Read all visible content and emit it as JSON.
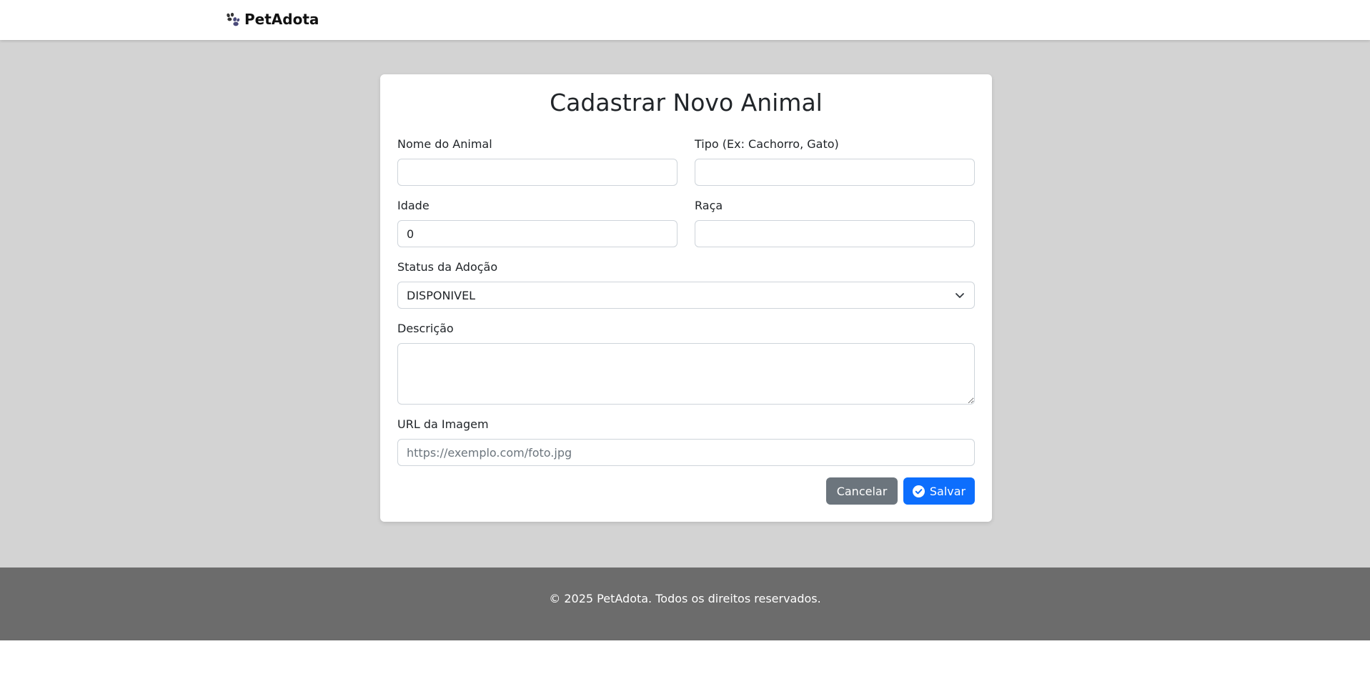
{
  "header": {
    "brand": "PetAdota",
    "brand_icon": "paw-icon"
  },
  "form": {
    "title": "Cadastrar Novo Animal",
    "nome": {
      "label": "Nome do Animal",
      "value": ""
    },
    "tipo": {
      "label": "Tipo (Ex: Cachorro, Gato)",
      "value": ""
    },
    "idade": {
      "label": "Idade",
      "value": "0"
    },
    "raca": {
      "label": "Raça",
      "value": ""
    },
    "status": {
      "label": "Status da Adoção",
      "value": "DISPONIVEL"
    },
    "descricao": {
      "label": "Descrição",
      "value": ""
    },
    "imagem": {
      "label": "URL da Imagem",
      "value": "",
      "placeholder": "https://exemplo.com/foto.jpg"
    },
    "buttons": {
      "cancel": "Cancelar",
      "save": "Salvar"
    }
  },
  "footer": {
    "text": "© 2025 PetAdota. Todos os direitos reservados."
  },
  "colors": {
    "primary": "#0d6efd",
    "secondary": "#6c757d",
    "background": "#d3d3d3",
    "footer": "#6c6c6c"
  }
}
